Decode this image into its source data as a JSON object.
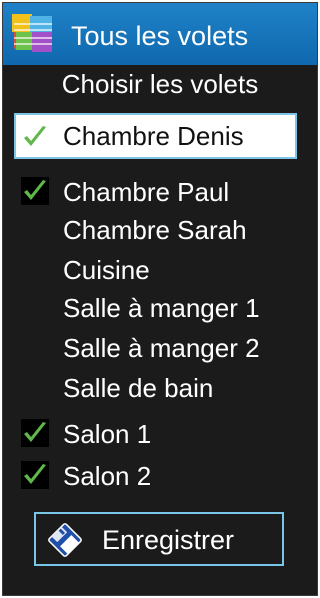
{
  "header": {
    "title": "Tous les volets",
    "icon": "blinds-app-icon"
  },
  "subtitle": "Choisir les volets",
  "items": [
    {
      "label": "Chambre Denis",
      "checked": true,
      "selected": true
    },
    {
      "label": "Chambre Paul",
      "checked": true,
      "selected": false
    },
    {
      "label": "Chambre Sarah",
      "checked": false,
      "selected": false
    },
    {
      "label": "Cuisine",
      "checked": false,
      "selected": false
    },
    {
      "label": "Salle à manger 1",
      "checked": false,
      "selected": false
    },
    {
      "label": "Salle à manger 2",
      "checked": false,
      "selected": false
    },
    {
      "label": "Salle de bain",
      "checked": false,
      "selected": false
    },
    {
      "label": "Salon 1",
      "checked": true,
      "selected": false
    },
    {
      "label": "Salon 2",
      "checked": true,
      "selected": false
    }
  ],
  "save_button": {
    "label": "Enregistrer",
    "icon": "floppy-disk-icon"
  },
  "colors": {
    "titlebar": "#1068ad",
    "background": "#1b1b1b",
    "checkmark": "#5fb84a",
    "accent_border": "#79c6e8"
  }
}
